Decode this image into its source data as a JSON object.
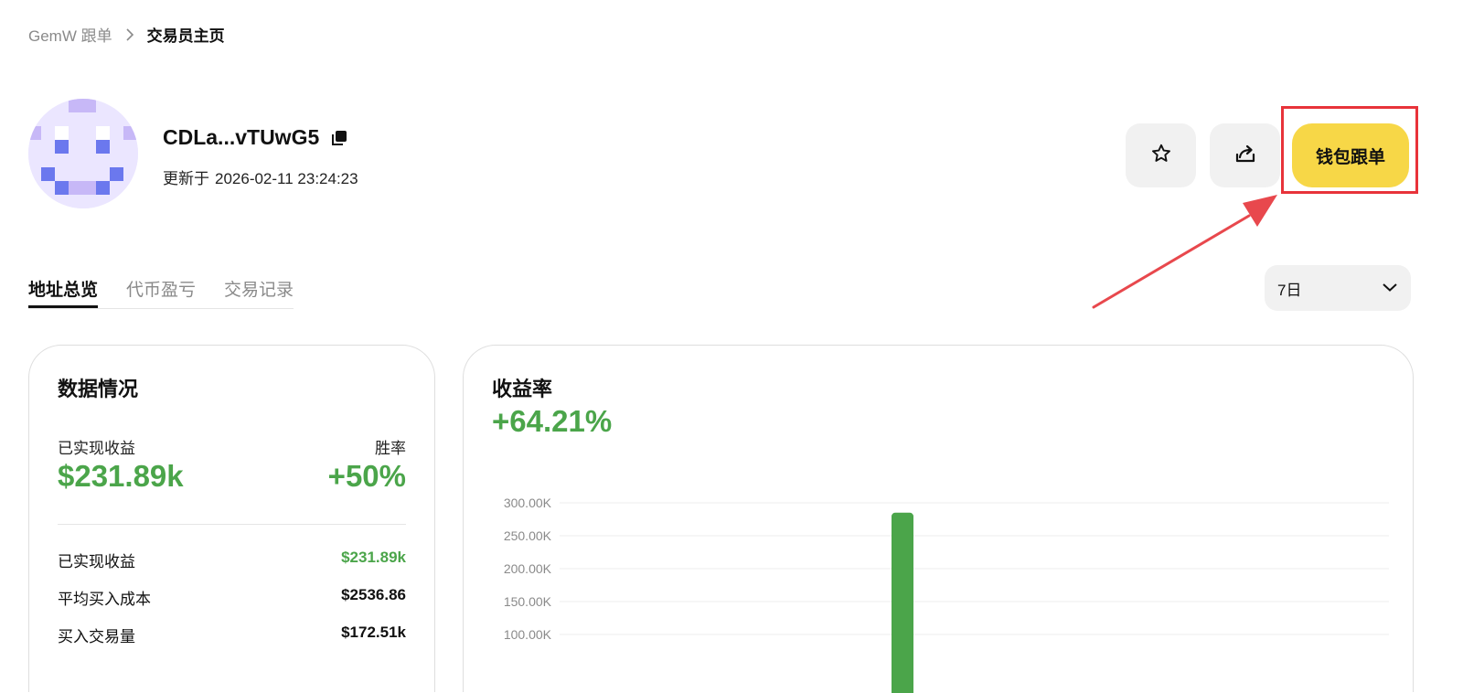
{
  "breadcrumb": {
    "parent": "GemW 跟单",
    "current": "交易员主页"
  },
  "profile": {
    "name": "CDLa...vTUwG5",
    "updated_prefix": "更新于",
    "updated_time": "2026-02-11 23:24:23"
  },
  "actions": {
    "copy_trade_label": "钱包跟单",
    "favorite_icon": "star-icon",
    "share_icon": "share-icon"
  },
  "tabs": [
    {
      "label": "地址总览",
      "active": true
    },
    {
      "label": "代币盈亏",
      "active": false
    },
    {
      "label": "交易记录",
      "active": false
    }
  ],
  "range": {
    "selected": "7日"
  },
  "data_card": {
    "title": "数据情况",
    "realized_label": "已实现收益",
    "realized_value": "$231.89k",
    "winrate_label": "胜率",
    "winrate_value": "+50%",
    "rows": [
      {
        "label": "已实现收益",
        "value": "$231.89k",
        "positive": true
      },
      {
        "label": "平均买入成本",
        "value": "$2536.86",
        "positive": false
      },
      {
        "label": "买入交易量",
        "value": "$172.51k",
        "positive": false
      }
    ]
  },
  "pnl_card": {
    "title": "收益率",
    "value": "+64.21%"
  },
  "colors": {
    "accent_green": "#4ba54a",
    "brand_yellow": "#f7d747",
    "highlight_red": "#e8333a"
  },
  "chart_data": {
    "type": "bar",
    "ylim": [
      0,
      300000
    ],
    "yticks": [
      100000,
      150000,
      200000,
      250000,
      300000
    ],
    "ytick_labels": [
      "100.00K",
      "150.00K",
      "200.00K",
      "250.00K",
      "300.00K"
    ],
    "series": [
      {
        "values": [
          285000
        ]
      }
    ]
  }
}
